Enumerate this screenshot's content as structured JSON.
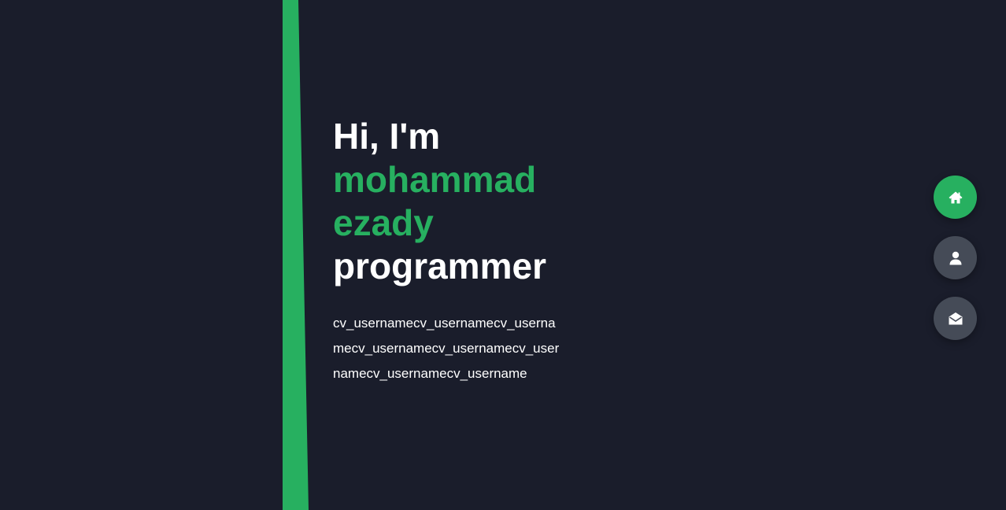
{
  "hero": {
    "greeting": "Hi, I'm",
    "name_first": "mohammad",
    "name_last": "ezady",
    "role": "programmer",
    "description": "cv_usernamecv_usernamecv_usernamecv_usernamecv_usernamecv_usernamecv_usernamecv_username"
  },
  "nav": {
    "items": [
      {
        "icon": "home-icon",
        "active": true
      },
      {
        "icon": "user-icon",
        "active": false
      },
      {
        "icon": "envelope-open-icon",
        "active": false
      }
    ]
  },
  "colors": {
    "background": "#1a1d2b",
    "accent": "#27b060",
    "button_inactive": "#454b57",
    "text": "#ffffff"
  }
}
